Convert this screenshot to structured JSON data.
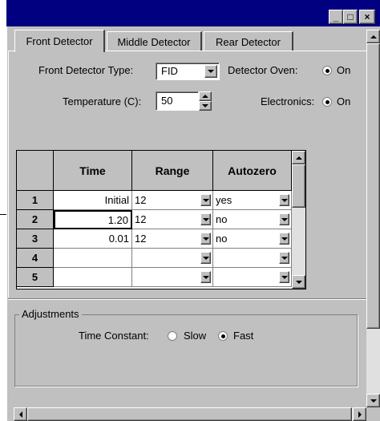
{
  "window": {
    "controls": {
      "minimize": "_",
      "maximize": "□",
      "close": "×"
    }
  },
  "tabs": [
    {
      "label": "Front Detector",
      "active": true
    },
    {
      "label": "Middle Detector",
      "active": false
    },
    {
      "label": "Rear Detector",
      "active": false
    }
  ],
  "settings": {
    "detector_type_label": "Front Detector Type:",
    "detector_type_value": "FID",
    "detector_oven_label": "Detector Oven:",
    "detector_oven_option": "On",
    "temperature_label": "Temperature (C):",
    "temperature_value": "50",
    "electronics_label": "Electronics:",
    "electronics_option": "On"
  },
  "table": {
    "columns": [
      "Time",
      "Range",
      "Autozero"
    ],
    "rows": [
      {
        "index": "1",
        "time": "Initial",
        "range": "12",
        "autozero": "yes"
      },
      {
        "index": "2",
        "time": "1.20",
        "range": "12",
        "autozero": "no"
      },
      {
        "index": "3",
        "time": "0.01",
        "range": "12",
        "autozero": "no"
      },
      {
        "index": "4",
        "time": "",
        "range": "",
        "autozero": ""
      },
      {
        "index": "5",
        "time": "",
        "range": "",
        "autozero": ""
      }
    ]
  },
  "adjustments": {
    "group_label": "Adjustments",
    "time_constant_label": "Time Constant:",
    "slow_label": "Slow",
    "fast_label": "Fast",
    "selected": "Fast"
  }
}
